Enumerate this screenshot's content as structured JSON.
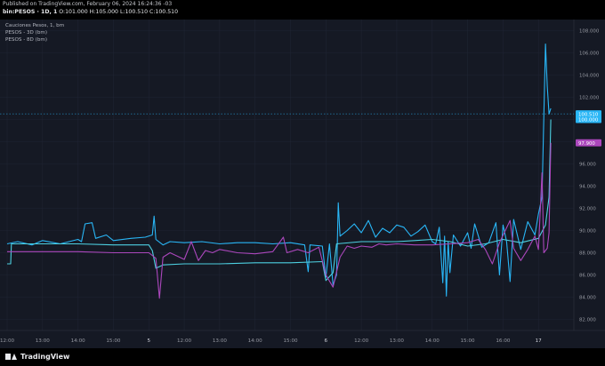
{
  "header": {
    "published": "Published on TradingView.com, February 06, 2024 16:24:36 -03",
    "symbol": "bin:PESOS · 1D, 1",
    "ohlc": "O:101.000 H:105.000 L:100.510 C:100.510"
  },
  "legend": {
    "title": "Cauciones Pesos, 1, bm",
    "items": [
      "PESOS - 3D (bm)",
      "PESOS - 8D (bm)"
    ]
  },
  "footer": {
    "brand": "TradingView"
  },
  "colors": {
    "bg": "#151924",
    "cyan": "#29b6f6",
    "teal": "#4dd0e1",
    "magenta": "#ab47bc",
    "grid": "#1f2433"
  },
  "chart_data": {
    "type": "line",
    "y_axis": {
      "ticks": [
        "108.000",
        "106.000",
        "104.000",
        "102.000",
        "100.000",
        "98.000",
        "96.000",
        "94.000",
        "92.000",
        "90.000",
        "88.000",
        "86.000",
        "84.000",
        "82.000"
      ],
      "range": [
        81,
        109
      ]
    },
    "x_axis": {
      "ticks": [
        "12:00",
        "13:00",
        "14:00",
        "15:00",
        "5",
        "12:00",
        "13:00",
        "14:00",
        "15:00",
        "6",
        "12:00",
        "13:00",
        "14:00",
        "15:00",
        "16:00",
        "17"
      ],
      "range": [
        0,
        16
      ]
    },
    "price_labels": [
      {
        "value": 100.51,
        "text": "100.510",
        "color": "#29b6f6"
      },
      {
        "value": 100.0,
        "text": "100.000",
        "color": "#29b6f6"
      },
      {
        "value": 97.9,
        "text": "97.900",
        "color": "#ab47bc"
      }
    ],
    "current_line": 100.51,
    "series": [
      {
        "color": "#29b6f6",
        "points": [
          [
            0,
            88.8
          ],
          [
            0.3,
            89.0
          ],
          [
            0.7,
            88.7
          ],
          [
            1.0,
            89.1
          ],
          [
            1.5,
            88.8
          ],
          [
            2.0,
            89.2
          ],
          [
            2.1,
            89.0
          ],
          [
            2.2,
            90.6
          ],
          [
            2.4,
            90.7
          ],
          [
            2.5,
            89.3
          ],
          [
            2.8,
            89.6
          ],
          [
            3.0,
            89.1
          ],
          [
            3.5,
            89.3
          ],
          [
            3.9,
            89.4
          ],
          [
            4.1,
            89.6
          ],
          [
            4.15,
            91.3
          ],
          [
            4.2,
            89.2
          ],
          [
            4.4,
            88.7
          ],
          [
            4.6,
            89.0
          ],
          [
            5.0,
            88.9
          ],
          [
            5.5,
            89.0
          ],
          [
            6.0,
            88.8
          ],
          [
            6.5,
            88.9
          ],
          [
            7.0,
            88.9
          ],
          [
            7.5,
            88.8
          ],
          [
            8.0,
            88.9
          ],
          [
            8.4,
            88.7
          ],
          [
            8.5,
            86.3
          ],
          [
            8.55,
            88.7
          ],
          [
            8.9,
            88.6
          ],
          [
            9.0,
            85.8
          ],
          [
            9.1,
            88.8
          ],
          [
            9.2,
            85.1
          ],
          [
            9.3,
            86.0
          ],
          [
            9.35,
            92.5
          ],
          [
            9.4,
            89.5
          ],
          [
            9.6,
            90.0
          ],
          [
            9.8,
            90.6
          ],
          [
            10.0,
            89.8
          ],
          [
            10.2,
            90.9
          ],
          [
            10.4,
            89.4
          ],
          [
            10.6,
            90.2
          ],
          [
            10.8,
            89.8
          ],
          [
            11.0,
            90.5
          ],
          [
            11.2,
            90.3
          ],
          [
            11.4,
            89.5
          ],
          [
            11.6,
            89.9
          ],
          [
            11.8,
            90.5
          ],
          [
            12.0,
            89.0
          ],
          [
            12.1,
            88.8
          ],
          [
            12.2,
            90.3
          ],
          [
            12.3,
            85.3
          ],
          [
            12.35,
            89.5
          ],
          [
            12.4,
            84.1
          ],
          [
            12.45,
            89.0
          ],
          [
            12.5,
            86.2
          ],
          [
            12.6,
            89.6
          ],
          [
            12.8,
            88.6
          ],
          [
            13.0,
            89.8
          ],
          [
            13.1,
            88.4
          ],
          [
            13.2,
            90.6
          ],
          [
            13.4,
            88.5
          ],
          [
            13.6,
            88.9
          ],
          [
            13.8,
            90.7
          ],
          [
            13.9,
            86.0
          ],
          [
            14.0,
            90.5
          ],
          [
            14.1,
            89.0
          ],
          [
            14.2,
            85.4
          ],
          [
            14.3,
            91.0
          ],
          [
            14.5,
            88.3
          ],
          [
            14.7,
            90.8
          ],
          [
            14.9,
            89.6
          ],
          [
            15.0,
            91.5
          ],
          [
            15.1,
            93.0
          ],
          [
            15.2,
            106.8
          ],
          [
            15.25,
            103.0
          ],
          [
            15.3,
            100.5
          ],
          [
            15.35,
            101.0
          ]
        ]
      },
      {
        "color": "#4dd0e1",
        "points": [
          [
            0,
            87.0
          ],
          [
            0.1,
            87.0
          ],
          [
            0.12,
            88.8
          ],
          [
            1.0,
            88.8
          ],
          [
            2.0,
            88.8
          ],
          [
            3.0,
            88.7
          ],
          [
            4.0,
            88.7
          ],
          [
            4.1,
            88.2
          ],
          [
            4.2,
            86.6
          ],
          [
            4.4,
            86.9
          ],
          [
            5.0,
            87.0
          ],
          [
            6.0,
            87.0
          ],
          [
            7.0,
            87.1
          ],
          [
            8.0,
            87.1
          ],
          [
            8.9,
            87.2
          ],
          [
            9.0,
            85.5
          ],
          [
            9.2,
            86.2
          ],
          [
            9.3,
            88.8
          ],
          [
            10.0,
            89.0
          ],
          [
            10.5,
            89.0
          ],
          [
            11.0,
            89.0
          ],
          [
            11.5,
            89.1
          ],
          [
            12.0,
            89.2
          ],
          [
            12.5,
            89.0
          ],
          [
            13.0,
            88.6
          ],
          [
            13.5,
            88.8
          ],
          [
            14.0,
            89.2
          ],
          [
            14.5,
            88.9
          ],
          [
            15.0,
            89.3
          ],
          [
            15.2,
            90.5
          ],
          [
            15.3,
            93.0
          ],
          [
            15.35,
            100.0
          ]
        ]
      },
      {
        "color": "#ab47bc",
        "points": [
          [
            0,
            88.1
          ],
          [
            1.0,
            88.1
          ],
          [
            2.0,
            88.1
          ],
          [
            3.0,
            88.0
          ],
          [
            4.0,
            88.0
          ],
          [
            4.2,
            87.5
          ],
          [
            4.3,
            83.9
          ],
          [
            4.4,
            87.6
          ],
          [
            4.6,
            88.0
          ],
          [
            5.0,
            87.4
          ],
          [
            5.2,
            89.0
          ],
          [
            5.4,
            87.3
          ],
          [
            5.6,
            88.2
          ],
          [
            5.8,
            88.0
          ],
          [
            6.0,
            88.3
          ],
          [
            6.5,
            88.0
          ],
          [
            7.0,
            87.9
          ],
          [
            7.5,
            88.1
          ],
          [
            7.8,
            89.4
          ],
          [
            7.9,
            88.0
          ],
          [
            8.2,
            88.3
          ],
          [
            8.5,
            88.0
          ],
          [
            8.8,
            88.5
          ],
          [
            9.0,
            86.0
          ],
          [
            9.2,
            84.9
          ],
          [
            9.4,
            87.6
          ],
          [
            9.6,
            88.6
          ],
          [
            9.8,
            88.4
          ],
          [
            10.0,
            88.6
          ],
          [
            10.3,
            88.5
          ],
          [
            10.5,
            88.8
          ],
          [
            10.7,
            88.7
          ],
          [
            11.0,
            88.8
          ],
          [
            11.5,
            88.7
          ],
          [
            12.0,
            88.7
          ],
          [
            12.5,
            88.8
          ],
          [
            13.0,
            88.9
          ],
          [
            13.3,
            89.2
          ],
          [
            13.5,
            88.3
          ],
          [
            13.7,
            87.0
          ],
          [
            13.9,
            88.9
          ],
          [
            14.2,
            90.9
          ],
          [
            14.3,
            88.4
          ],
          [
            14.5,
            87.3
          ],
          [
            14.7,
            88.3
          ],
          [
            14.9,
            89.5
          ],
          [
            15.0,
            88.3
          ],
          [
            15.1,
            95.2
          ],
          [
            15.15,
            88.0
          ],
          [
            15.25,
            88.4
          ],
          [
            15.3,
            89.8
          ],
          [
            15.35,
            97.9
          ]
        ]
      }
    ]
  }
}
